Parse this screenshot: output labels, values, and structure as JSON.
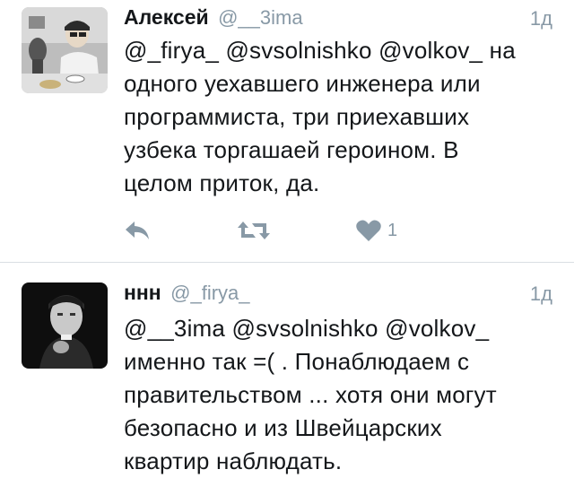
{
  "tweets": [
    {
      "display_name": "Алексей",
      "handle": "@__3ima",
      "time": "1д",
      "text": "@_firya_ @svsolnishko @volkov_ на\nодного уехавшего инженера или\nпрограммиста, три приехавших\nузбека торгашаей героином. В\nцелом приток, да.",
      "like_count": "1"
    },
    {
      "display_name": "ннн",
      "handle": "@_firya_",
      "time": "1д",
      "text": "@__3ima @svsolnishko @volkov_\nименно так =( . Понаблюдаем  с\nправительством ... хотя они могут\nбезопасно и из Швейцарских\nквартир наблюдать."
    }
  ],
  "icons": {
    "reply": "reply-icon",
    "retweet": "retweet-icon",
    "like": "heart-icon"
  },
  "colors": {
    "text": "#14171a",
    "meta": "#8899a6",
    "divider": "#dadfe3"
  }
}
